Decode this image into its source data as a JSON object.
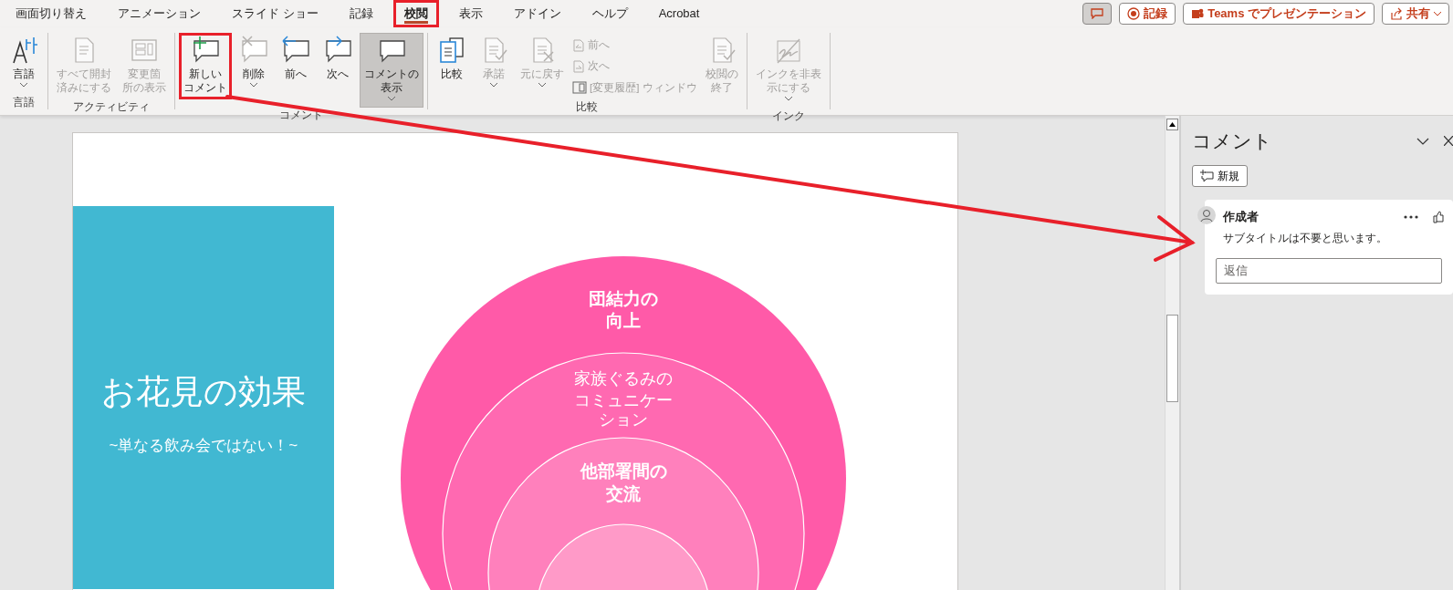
{
  "tabs": [
    {
      "label": "画面切り替え",
      "selected": false,
      "highlighted": false
    },
    {
      "label": "アニメーション",
      "selected": false,
      "highlighted": false
    },
    {
      "label": "スライド ショー",
      "selected": false,
      "highlighted": false
    },
    {
      "label": "記録",
      "selected": false,
      "highlighted": false
    },
    {
      "label": "校閲",
      "selected": true,
      "highlighted": true
    },
    {
      "label": "表示",
      "selected": false,
      "highlighted": false
    },
    {
      "label": "アドイン",
      "selected": false,
      "highlighted": false
    },
    {
      "label": "ヘルプ",
      "selected": false,
      "highlighted": false
    },
    {
      "label": "Acrobat",
      "selected": false,
      "highlighted": false
    }
  ],
  "top_buttons": [
    {
      "kind": "comments",
      "pressed": true
    },
    {
      "kind": "record",
      "label": "記録"
    },
    {
      "kind": "teams",
      "label": "Teams でプレゼンテーション"
    },
    {
      "kind": "share",
      "label": "共有",
      "dropdown": true
    }
  ],
  "ribbon": {
    "groups": [
      {
        "label": "言語",
        "items": [
          {
            "kind": "large",
            "label": "言語",
            "dropdown": true,
            "disabled": false,
            "pressed": false,
            "highlighted": false
          }
        ]
      },
      {
        "label": "アクティビティ",
        "items": [
          {
            "kind": "large",
            "label_lines": [
              "すべて開封",
              "済みにする"
            ],
            "dropdown": false,
            "disabled": true,
            "pressed": false,
            "highlighted": false
          },
          {
            "kind": "large",
            "label_lines": [
              "変更箇",
              "所の表示"
            ],
            "dropdown": false,
            "disabled": true,
            "pressed": false,
            "highlighted": false
          }
        ]
      },
      {
        "label": "コメント",
        "items": [
          {
            "kind": "large",
            "label_lines": [
              "新しい",
              "コメント"
            ],
            "dropdown": false,
            "disabled": false,
            "pressed": false,
            "highlighted": true
          },
          {
            "kind": "large",
            "label": "削除",
            "dropdown": true,
            "disabled": false,
            "pressed": false,
            "highlighted": false
          },
          {
            "kind": "large",
            "label": "前へ",
            "dropdown": false,
            "disabled": false,
            "pressed": false,
            "highlighted": false
          },
          {
            "kind": "large",
            "label": "次へ",
            "dropdown": false,
            "disabled": false,
            "pressed": false,
            "highlighted": false
          },
          {
            "kind": "large",
            "label_lines": [
              "コメントの",
              "表示"
            ],
            "dropdown": true,
            "disabled": false,
            "pressed": true,
            "highlighted": false
          }
        ]
      },
      {
        "label": "比較",
        "items": [
          {
            "kind": "large",
            "label": "比較",
            "dropdown": false,
            "disabled": false,
            "pressed": false,
            "highlighted": false
          },
          {
            "kind": "large",
            "label": "承諾",
            "dropdown": true,
            "disabled": true,
            "pressed": false,
            "highlighted": false
          },
          {
            "kind": "large",
            "label": "元に戻す",
            "dropdown": true,
            "disabled": true,
            "pressed": false,
            "highlighted": false
          },
          {
            "kind": "small",
            "label": "前へ",
            "disabled": true
          },
          {
            "kind": "small",
            "label": "次へ",
            "disabled": true
          },
          {
            "kind": "small",
            "label": "[変更履歴] ウィンドウ",
            "disabled": true
          },
          {
            "kind": "large",
            "label_lines": [
              "校閲の",
              "終了"
            ],
            "dropdown": false,
            "disabled": true,
            "pressed": false,
            "highlighted": false
          }
        ]
      },
      {
        "label": "インク",
        "items": [
          {
            "kind": "large",
            "label_lines": [
              "インクを非表",
              "示にする"
            ],
            "dropdown": true,
            "disabled": true,
            "pressed": false,
            "highlighted": false
          }
        ]
      }
    ]
  },
  "slide": {
    "title": "お花見の効果",
    "subtitle": "~単なる飲み会ではない！~",
    "rings": [
      {
        "color": "#ff5aa8",
        "lines": [
          "団結力の",
          "向上"
        ]
      },
      {
        "color": "#ff69b1",
        "lines": [
          "家族ぐるみの",
          "コミュニケー",
          "ション"
        ]
      },
      {
        "color": "#ff80bc",
        "lines": [
          "他部署間の",
          "交流"
        ]
      },
      {
        "color": "#ff9ac8"
      }
    ]
  },
  "comments_pane": {
    "title": "コメント",
    "new_button": "新規",
    "comments": [
      {
        "author": "作成者",
        "text": "サブタイトルは不要と思います。",
        "reply_placeholder": "返信"
      }
    ]
  }
}
